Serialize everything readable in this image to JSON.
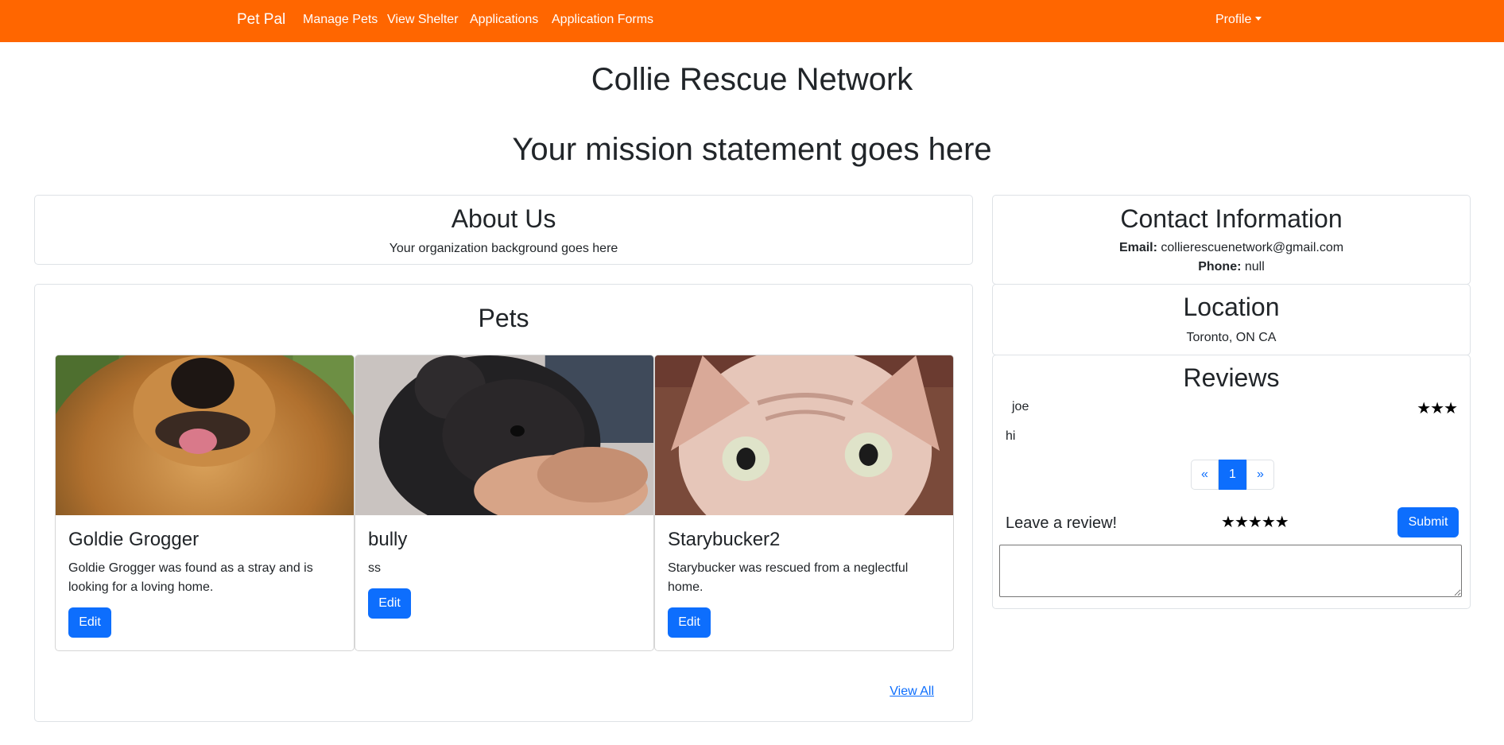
{
  "navbar": {
    "brand": "Pet Pal",
    "links": [
      "Manage Pets",
      "View Shelter",
      "Applications",
      "Application Forms"
    ],
    "profile": "Profile"
  },
  "shelter": {
    "name": "Collie Rescue Network",
    "mission": "Your mission statement goes here"
  },
  "about": {
    "title": "About Us",
    "text": "Your organization background goes here"
  },
  "pets": {
    "title": "Pets",
    "items": [
      {
        "name": "Goldie Grogger",
        "description": "Goldie Grogger was found as a stray and is looking for a loving home.",
        "button": "Edit"
      },
      {
        "name": "bully",
        "description": "ss",
        "button": "Edit"
      },
      {
        "name": "Starybucker2",
        "description": "Starybucker was rescued from a neglectful home.",
        "button": "Edit"
      }
    ],
    "view_all": "View All"
  },
  "contact": {
    "title": "Contact Information",
    "email_label": "Email:",
    "email": "collierescuenetwork@gmail.com",
    "phone_label": "Phone:",
    "phone": "null"
  },
  "location": {
    "title": "Location",
    "text": "Toronto, ON CA"
  },
  "reviews": {
    "title": "Reviews",
    "items": [
      {
        "author": "joe",
        "rating": 3,
        "text": "hi"
      }
    ],
    "pagination": {
      "prev": "«",
      "current": "1",
      "next": "»"
    },
    "leave_label": "Leave a review!",
    "input_rating": 5,
    "submit": "Submit"
  }
}
